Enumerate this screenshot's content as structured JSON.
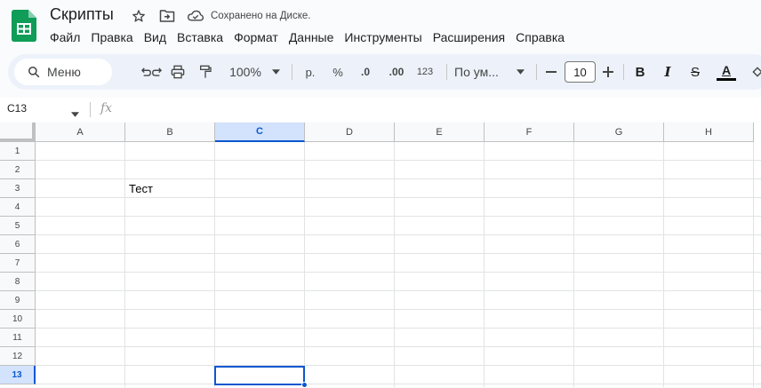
{
  "document": {
    "title": "Скрипты",
    "status": "Сохранено на Диске."
  },
  "menu": [
    "Файл",
    "Правка",
    "Вид",
    "Вставка",
    "Формат",
    "Данные",
    "Инструменты",
    "Расширения",
    "Справка"
  ],
  "toolbar": {
    "search_label": "Меню",
    "zoom": "100%",
    "currency": "р.",
    "percent": "%",
    "decimal_decrease": ".0",
    "decimal_increase": ".00",
    "number_format": "123",
    "font": "По ум...",
    "font_size": "10",
    "bold": "B",
    "italic": "I",
    "strike": "S",
    "text_color": "A"
  },
  "formula_bar": {
    "name_box": "C13",
    "fx": "fx",
    "value": ""
  },
  "grid": {
    "columns": [
      "A",
      "B",
      "C",
      "D",
      "E",
      "F",
      "G",
      "H"
    ],
    "rows": [
      "1",
      "2",
      "3",
      "4",
      "5",
      "6",
      "7",
      "8",
      "9",
      "10",
      "11",
      "12",
      "13"
    ],
    "selected_cell": "C13",
    "cells": {
      "B3": "Тест"
    }
  },
  "colors": {
    "accent": "#0b57d0",
    "selection_header": "#d3e3fd",
    "toolbar_bg": "#edf2fa",
    "sheets_green": "#0f9d58"
  }
}
